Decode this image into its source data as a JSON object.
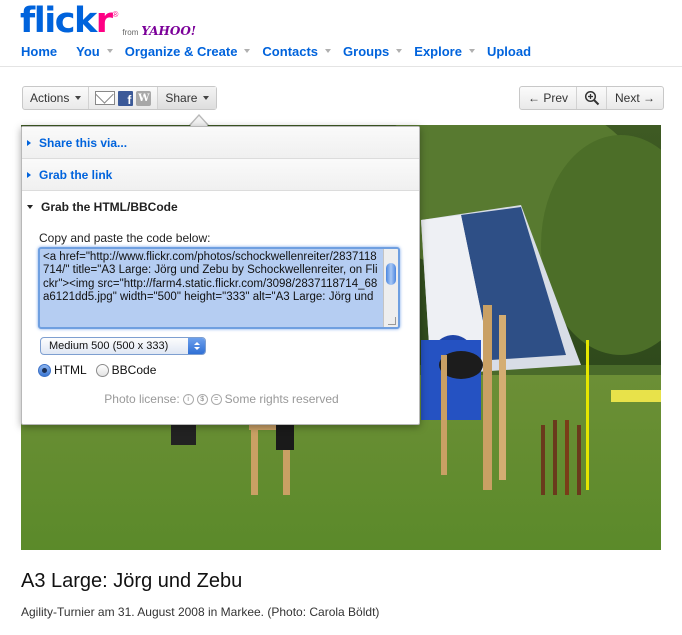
{
  "logo": {
    "flickr_blue": "flick",
    "flickr_pink": "r",
    "registered": "®",
    "from": "from",
    "yahoo": "YAHOO!"
  },
  "nav": {
    "items": [
      {
        "label": "Home",
        "dropdown": false
      },
      {
        "label": "You",
        "dropdown": true
      },
      {
        "label": "Organize & Create",
        "dropdown": true
      },
      {
        "label": "Contacts",
        "dropdown": true
      },
      {
        "label": "Groups",
        "dropdown": true
      },
      {
        "label": "Explore",
        "dropdown": true
      },
      {
        "label": "Upload",
        "dropdown": false
      }
    ]
  },
  "toolbar": {
    "actions_label": "Actions",
    "share_label": "Share"
  },
  "photo_nav": {
    "prev_label": "← Prev",
    "next_label": "Next →"
  },
  "share_panel": {
    "share_via": "Share this via...",
    "grab_link": "Grab the link",
    "grab_html": "Grab the HTML/BBCode",
    "copy_label": "Copy and paste the code below:",
    "code": "<a href=\"http://www.flickr.com/photos/schockwellenreiter/2837118714/\" title=\"A3 Large: Jörg und Zebu by Schockwellenreiter, on Flickr\"><img src=\"http://farm4.static.flickr.com/3098/2837118714_68a6121dd5.jpg\" width=\"500\" height=\"333\" alt=\"A3 Large: Jörg und",
    "size_select": "Medium 500 (500 x 333)",
    "format_html": "HTML",
    "format_bbcode": "BBCode",
    "license_label": "Photo license:",
    "license_text": "Some rights reserved"
  },
  "photo": {
    "title": "A3 Large: Jörg und Zebu",
    "description": "Agility-Turnier am 31. August 2008 in Markee. (Photo: Carola Böldt)"
  },
  "colors": {
    "flickr_blue": "#0063dc",
    "flickr_pink": "#ff0084",
    "yahoo_purple": "#7b0099",
    "grass": "#5f8a2c"
  }
}
